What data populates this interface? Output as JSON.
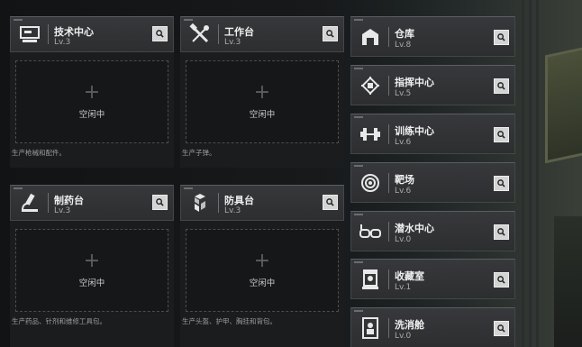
{
  "workshops": [
    {
      "name": "技术中心",
      "level": "Lv.3",
      "status": "空闲中",
      "desc": "生产枪械和配件。",
      "icon": "computer-terminal-icon"
    },
    {
      "name": "工作台",
      "level": "Lv.3",
      "status": "空闲中",
      "desc": "生产子弹。",
      "icon": "crossed-tools-icon"
    },
    {
      "name": "制药台",
      "level": "Lv.3",
      "status": "空闲中",
      "desc": "生产药品、针剂和维修工具包。",
      "icon": "microscope-icon"
    },
    {
      "name": "防具台",
      "level": "Lv.3",
      "status": "空闲中",
      "desc": "生产头盔、护甲、胸挂和背包。",
      "icon": "armor-cubes-icon"
    }
  ],
  "facilities": [
    {
      "name": "仓库",
      "level": "Lv.8",
      "icon": "warehouse-icon"
    },
    {
      "name": "指挥中心",
      "level": "Lv.5",
      "icon": "command-chip-icon"
    },
    {
      "name": "训练中心",
      "level": "Lv.6",
      "icon": "dumbbell-icon"
    },
    {
      "name": "靶场",
      "level": "Lv.6",
      "icon": "target-icon"
    },
    {
      "name": "潜水中心",
      "level": "Lv.0",
      "icon": "diving-mask-icon"
    },
    {
      "name": "收藏室",
      "level": "Lv.1",
      "icon": "trophy-case-icon"
    },
    {
      "name": "洗消舱",
      "level": "Lv.0",
      "icon": "decontamination-pod-icon"
    }
  ],
  "colors": {
    "search_button": "#d4d4d4",
    "header": "#333538",
    "panel": "#1b1c1e"
  }
}
